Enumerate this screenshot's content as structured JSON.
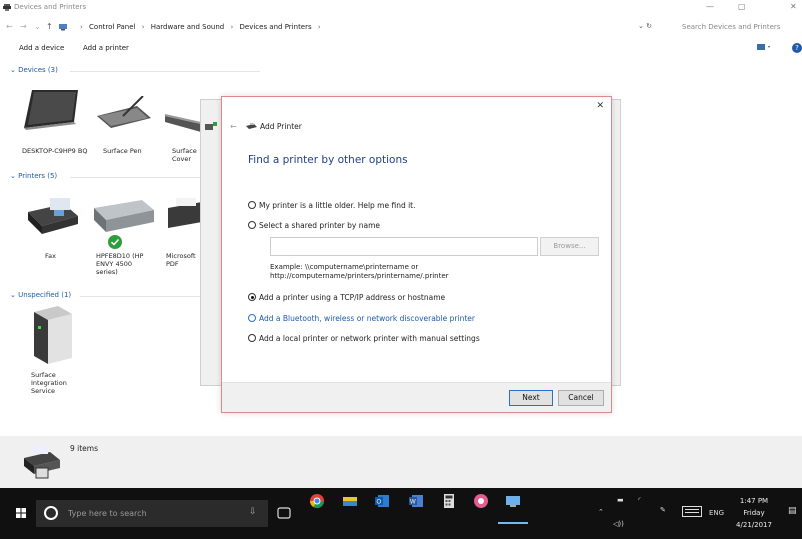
{
  "window": {
    "title": "Devices and Printers",
    "breadcrumbs": [
      "Control Panel",
      "Hardware and Sound",
      "Devices and Printers"
    ],
    "search_placeholder": "Search Devices and Printers"
  },
  "commands": {
    "add_device": "Add a device",
    "add_printer": "Add a printer"
  },
  "groups": {
    "devices": "Devices (3)",
    "printers": "Printers (5)",
    "unspecified": "Unspecified (1)"
  },
  "devices": [
    {
      "label": "DESKTOP-C9HP9 BQ"
    },
    {
      "label": "Surface Pen"
    },
    {
      "label": "Surface Cover"
    }
  ],
  "printers": [
    {
      "label": "Fax"
    },
    {
      "label": "HPFE8D10 (HP ENVY 4500 series)"
    },
    {
      "label": "Microsoft PDF"
    }
  ],
  "unspecified": [
    {
      "label": "Surface Integration Service"
    }
  ],
  "status": {
    "count": "9 items"
  },
  "dialog": {
    "title": "Add Printer",
    "heading": "Find a printer by other options",
    "options": [
      {
        "label": "My printer is a little older. Help me find it.",
        "selected": false
      },
      {
        "label": "Select a shared printer by name",
        "selected": false
      },
      {
        "label": "Add a printer using a TCP/IP address or hostname",
        "selected": true
      },
      {
        "label": "Add a Bluetooth, wireless or network discoverable printer",
        "selected": false
      },
      {
        "label": "Add a local printer or network printer with manual settings",
        "selected": false
      }
    ],
    "browse": "Browse...",
    "example_line1": "Example: \\\\computername\\printername or",
    "example_line2": "http://computername/printers/printername/.printer",
    "next": "Next",
    "cancel": "Cancel"
  },
  "taskbar": {
    "search_placeholder": "Type here to search",
    "language": "ENG",
    "time": "1:47 PM",
    "day": "Friday",
    "date": "4/21/2017"
  },
  "colors": {
    "accent": "#1e5aa8",
    "dialog_border": "#d98a8a",
    "taskbar": "#101010"
  }
}
